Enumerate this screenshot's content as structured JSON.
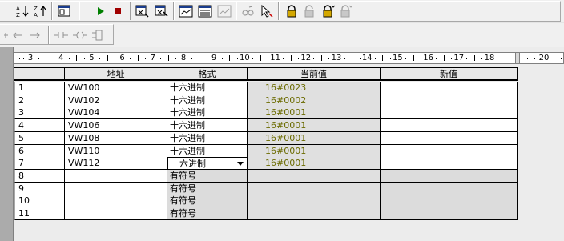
{
  "toolbar": {
    "row1": [
      "sort-ascending-icon",
      "sort-descending-icon",
      "window-layout-icon",
      "run-icon",
      "stop-icon",
      "single-read-icon",
      "write-all-icon",
      "chart-status-icon",
      "table-status-icon",
      "trend-icon",
      "pause-glasses-icon",
      "pointer-write-icon",
      "lock-icon",
      "unlock-icon",
      "force-icon",
      "unforce-icon"
    ],
    "row2": [
      "cut-icon",
      "undo-arrow-icon",
      "redo-arrow-icon",
      "insert-contact-icon",
      "insert-coil-icon",
      "insert-box-icon"
    ]
  },
  "ruler": {
    "labels": [
      "3",
      "4",
      "5",
      "6",
      "7",
      "8",
      "9",
      "10",
      "11",
      "12",
      "13",
      "14",
      "15",
      "16",
      "17",
      "18",
      "20"
    ]
  },
  "table": {
    "headers": [
      "",
      "地址",
      "格式",
      "当前值",
      "新值"
    ],
    "rows": [
      {
        "n": "1",
        "address": "VW100",
        "format": "十六进制",
        "current": "16#0023",
        "new": ""
      },
      {
        "n": "2",
        "address": "VW102",
        "format": "十六进制",
        "current": "16#0002",
        "new": ""
      },
      {
        "n": "3",
        "address": "VW104",
        "format": "十六进制",
        "current": "16#0001",
        "new": ""
      },
      {
        "n": "4",
        "address": "VW106",
        "format": "十六进制",
        "current": "16#0001",
        "new": ""
      },
      {
        "n": "5",
        "address": "VW108",
        "format": "十六进制",
        "current": "16#0001",
        "new": ""
      },
      {
        "n": "6",
        "address": "VW110",
        "format": "十六进制",
        "current": "16#0001",
        "new": ""
      },
      {
        "n": "7",
        "address": "VW112",
        "format": "十六进制",
        "current": "16#0001",
        "new": ""
      },
      {
        "n": "8",
        "address": "",
        "format": "有符号",
        "current": "",
        "new": ""
      },
      {
        "n": "9",
        "address": "",
        "format": "有符号",
        "current": "",
        "new": ""
      },
      {
        "n": "10",
        "address": "",
        "format": "有符号",
        "current": "",
        "new": ""
      },
      {
        "n": "11",
        "address": "",
        "format": "有符号",
        "current": "",
        "new": ""
      }
    ]
  },
  "colors": {
    "current_value_text": "#6b6b00",
    "run_green": "#008000",
    "stop_red": "#a00000"
  }
}
